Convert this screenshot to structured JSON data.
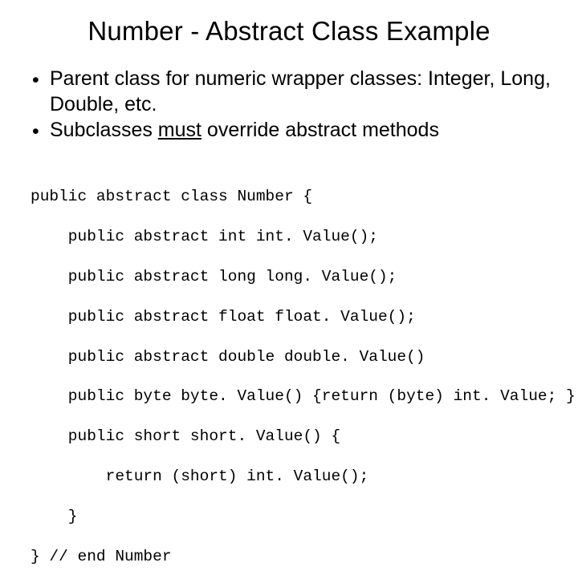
{
  "title": "Number - Abstract Class Example",
  "bullets": [
    {
      "dot": "•",
      "text_a": "Parent class for numeric wrapper classes: Integer, Long, Double, etc."
    },
    {
      "dot": "•",
      "text_b1": "Subclasses ",
      "text_b2": "must",
      "text_b3": " override abstract methods"
    }
  ],
  "code": {
    "l0": "public abstract class Number {",
    "l1": "    public abstract int int. Value();",
    "l2": "    public abstract long long. Value();",
    "l3": "    public abstract float float. Value();",
    "l4": "    public abstract double double. Value()",
    "l5": "    public byte byte. Value() {return (byte) int. Value; }",
    "l6": "    public short short. Value() {",
    "l7": "        return (short) int. Value();",
    "l8": "    }",
    "l9": "} // end Number"
  }
}
